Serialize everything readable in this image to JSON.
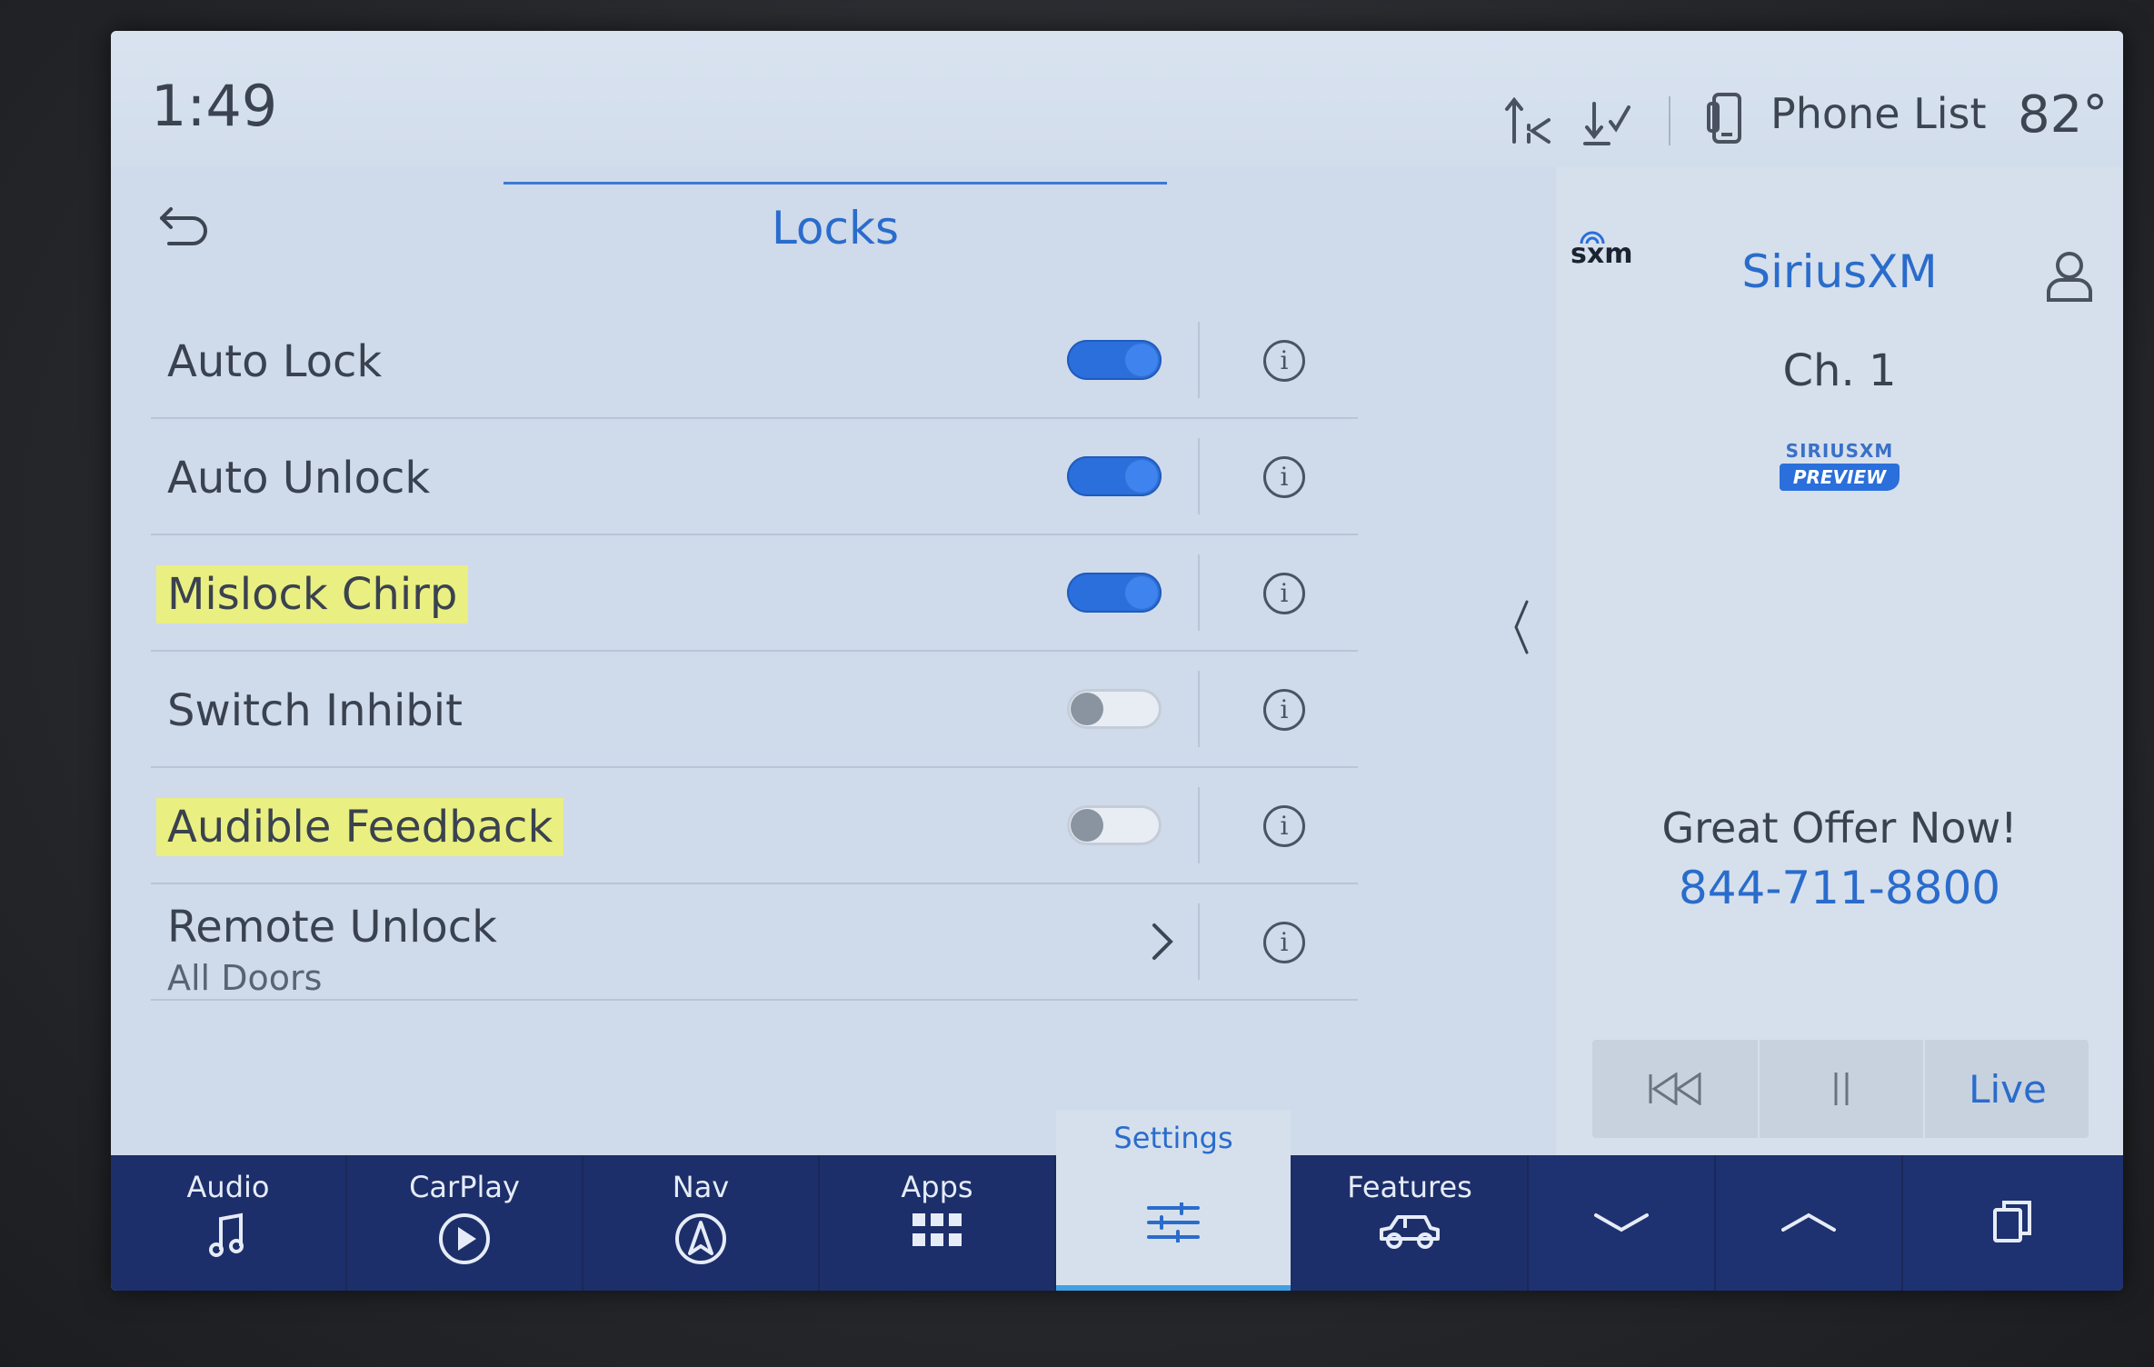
{
  "status_bar": {
    "time": "1:49",
    "phone_label": "Phone List",
    "temperature": "82°",
    "icons": [
      "signal-up-icon",
      "signal-down-icon",
      "phone-icon"
    ]
  },
  "page": {
    "title": "Locks",
    "back_icon": "back-arrow-icon"
  },
  "settings": [
    {
      "label": "Auto Lock",
      "control": "toggle",
      "on": true,
      "highlighted": false
    },
    {
      "label": "Auto Unlock",
      "control": "toggle",
      "on": true,
      "highlighted": false
    },
    {
      "label": "Mislock Chirp",
      "control": "toggle",
      "on": true,
      "highlighted": true
    },
    {
      "label": "Switch Inhibit",
      "control": "toggle",
      "on": false,
      "highlighted": false
    },
    {
      "label": "Audible Feedback",
      "control": "toggle",
      "on": false,
      "highlighted": true
    },
    {
      "label": "Remote Unlock",
      "sublabel": "All Doors",
      "control": "chevron",
      "highlighted": false
    }
  ],
  "media_panel": {
    "logo": "sxm",
    "title": "SiriusXM",
    "channel": "Ch. 1",
    "badge_top": "SIRIUSXM",
    "badge_bottom": "PREVIEW",
    "offer": "Great Offer Now!",
    "offer_phone": "844-711-8800",
    "live_label": "Live"
  },
  "bottom_nav": {
    "items": [
      {
        "label": "Audio",
        "icon": "music-note-icon"
      },
      {
        "label": "CarPlay",
        "icon": "play-circle-icon"
      },
      {
        "label": "Nav",
        "icon": "navigation-icon"
      },
      {
        "label": "Apps",
        "icon": "apps-grid-icon"
      },
      {
        "label": "Settings",
        "icon": "sliders-icon",
        "active": true
      },
      {
        "label": "Features",
        "icon": "vehicle-icon"
      }
    ]
  },
  "colors": {
    "accent": "#2a6ccc",
    "toggle_on": "#2a6fdb",
    "highlight": "#eef26e",
    "nav_bg": "#1d2f6a",
    "screen_bg": "#cfdaea"
  }
}
